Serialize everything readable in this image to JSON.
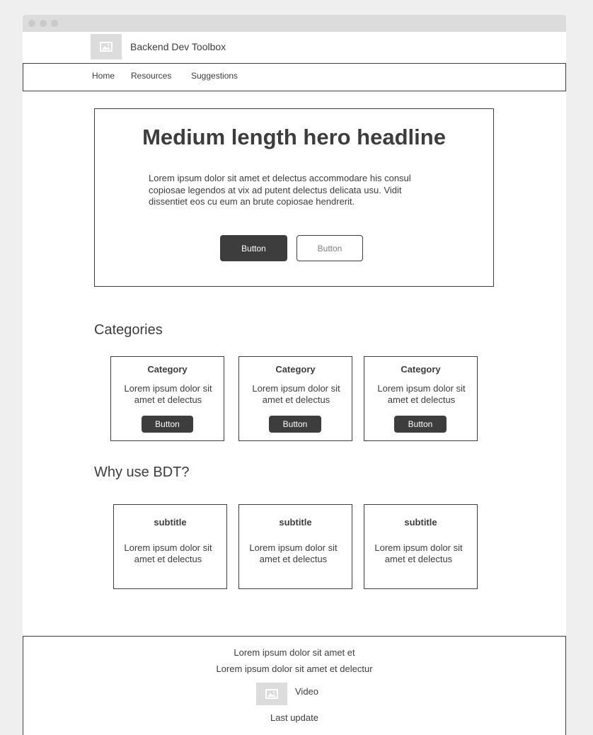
{
  "brand": {
    "name": "Backend Dev Toolbox"
  },
  "nav": {
    "items": [
      {
        "label": "Home"
      },
      {
        "label": "Resources"
      },
      {
        "label": "Suggestions"
      }
    ]
  },
  "hero": {
    "headline": "Medium length hero headline",
    "body": "Lorem ipsum dolor sit amet et delectus accommodare his consul copiosae legendos at vix ad putent delectus delicata usu. Vidit dissentiet eos cu eum an brute copiosae hendrerit.",
    "primary_button": "Button",
    "secondary_button": "Button"
  },
  "categories": {
    "heading": "Categories",
    "cards": [
      {
        "title": "Category",
        "text": "Lorem ipsum dolor sit amet et delectus",
        "button": "Button"
      },
      {
        "title": "Category",
        "text": "Lorem ipsum dolor sit amet et delectus",
        "button": "Button"
      },
      {
        "title": "Category",
        "text": "Lorem ipsum dolor sit amet et delectus",
        "button": "Button"
      }
    ]
  },
  "why": {
    "heading": "Why use BDT?",
    "cards": [
      {
        "title": "subtitle",
        "text": "Lorem ipsum dolor sit amet et delectus"
      },
      {
        "title": "subtitle",
        "text": "Lorem ipsum dolor sit amet et delectus"
      },
      {
        "title": "subtitle",
        "text": "Lorem ipsum dolor sit amet et delectus"
      }
    ]
  },
  "footer": {
    "line1": "Lorem ipsum dolor sit amet et",
    "line2": "Lorem ipsum dolor sit amet et delectur",
    "video_label": "Video",
    "last_update": "Last update"
  },
  "colors": {
    "page_background": "#efefef",
    "dark": "#3d3d3d",
    "placeholder": "#dcdcdc"
  },
  "icons": {
    "logo": "image-placeholder-icon",
    "video": "image-placeholder-icon"
  }
}
